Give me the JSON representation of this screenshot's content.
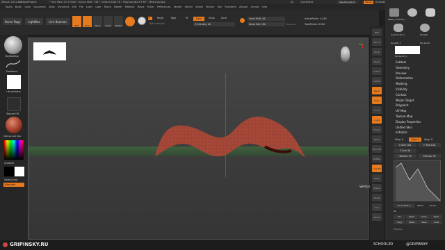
{
  "titlebar": {
    "app": "ZBrush 2021.6.2",
    "project": "DefaultProject",
    "stats": "• Free Mem 23.175GB • Active Mem 738 • Scratch Disk 78 • PolyCount▸0.97 KP • MeshCount▸1",
    "ac": "AC",
    "quicksave": "QuickSave",
    "seethrough": "See-through 0",
    "menus_btn": "Menus",
    "defaultscript": "DefaultZScript"
  },
  "menubar": [
    "Alpha",
    "Brush",
    "Color",
    "Document",
    "Draw",
    "Dynamics",
    "Edit",
    "File",
    "Layer",
    "Light",
    "Macro",
    "Marker",
    "Material",
    "Movie",
    "Picker",
    "Preferences",
    "Render",
    "Stencil",
    "Stroke",
    "Texture",
    "Tool",
    "Transform",
    "Zplugin",
    "Zscript",
    "Help"
  ],
  "toolbar": {
    "home": "Home Page",
    "lightbox": "LightBox",
    "livebool": "Live Boolean",
    "tools": [
      "Edit",
      "Draw",
      "Move",
      "Scale",
      "Rotate"
    ],
    "mrgb": "Mrgb",
    "rgb": "Rgb",
    "m": "M",
    "zadd": "Zadd",
    "zsub": "Zsub",
    "zcut": "Zcut",
    "rgb_intensity": "Rgb Intensity",
    "z_intensity": "Z Intensity 20",
    "focal_shift": "Focal Shift -56",
    "draw_size": "Draw Size 180",
    "dynamic": "Dynamic",
    "active_points": "ActivePoints: 0.284",
    "total_points": "TotalPoints: 0.284"
  },
  "leftpanel": {
    "brush": "ClayBuildup",
    "stroke": "FreeHand",
    "alpha": "~BrushAlpha",
    "texture": "Texture Off",
    "material": "MatCap Red Wax",
    "gradient": "Gradient",
    "switchcolor": "SwitchColor",
    "alternate": "Alternate"
  },
  "rightstrip": [
    "BPR",
    "SPix 3",
    "Scroll",
    "Zoom",
    "Actual",
    "AAHalf",
    "Persp",
    "Floor",
    "Local",
    "L.Sym",
    "Frame",
    "Move",
    "Zoom3D",
    "Rotate",
    "Line Fill",
    "PolyF",
    "Transp",
    "Ghost",
    "Solo",
    "Xpose"
  ],
  "rightpanel": {
    "tool_thumbs": [
      "PM3D_Cube3D_1",
      "Cylinder3D_1",
      "Ring3D",
      "Ring3D_1",
      "Terrain3D",
      "Terrain3D_1"
    ],
    "palette": [
      "Subtool",
      "Geometry",
      "Preview",
      "Deformation",
      "Masking",
      "Visibility",
      "Contact",
      "Morph Target",
      "Polypaint",
      "UV Map",
      "Texture Map",
      "Display Properties",
      "Unified Skin",
      "Initialize"
    ],
    "align_y": "Align Y",
    "align_z": "Align Z",
    "align_x": "Align X",
    "xsize": "X Size 100",
    "ysize": "Y Size 100",
    "zsize": "Z Size 30",
    "hdivide": "HDivide 78",
    "vdivide": "VDivide 78",
    "vertical_profile": "Vertical Profile",
    "focal_shift": "Focal Shift 0",
    "offset": "Offset",
    "reuse": "Reuse",
    "pa": "Pa",
    "btns1": [
      "Rt",
      "Rsetn",
      "Undo",
      "Redo"
    ],
    "btns2": [
      "Copy",
      "Paste",
      "Save",
      "Load"
    ],
    "hradius": "HRadius"
  },
  "viewport": {
    "tooltip": "Vertical Profile"
  },
  "watermarks": {
    "left": "GRIPINSKY.RU",
    "right1": "SCHOOL3D",
    "right2": "@GRIPINSKY"
  },
  "colors": {
    "accent": "#e57a1e",
    "mesh": "#a84a3a",
    "floor": "#3f7a3f"
  }
}
